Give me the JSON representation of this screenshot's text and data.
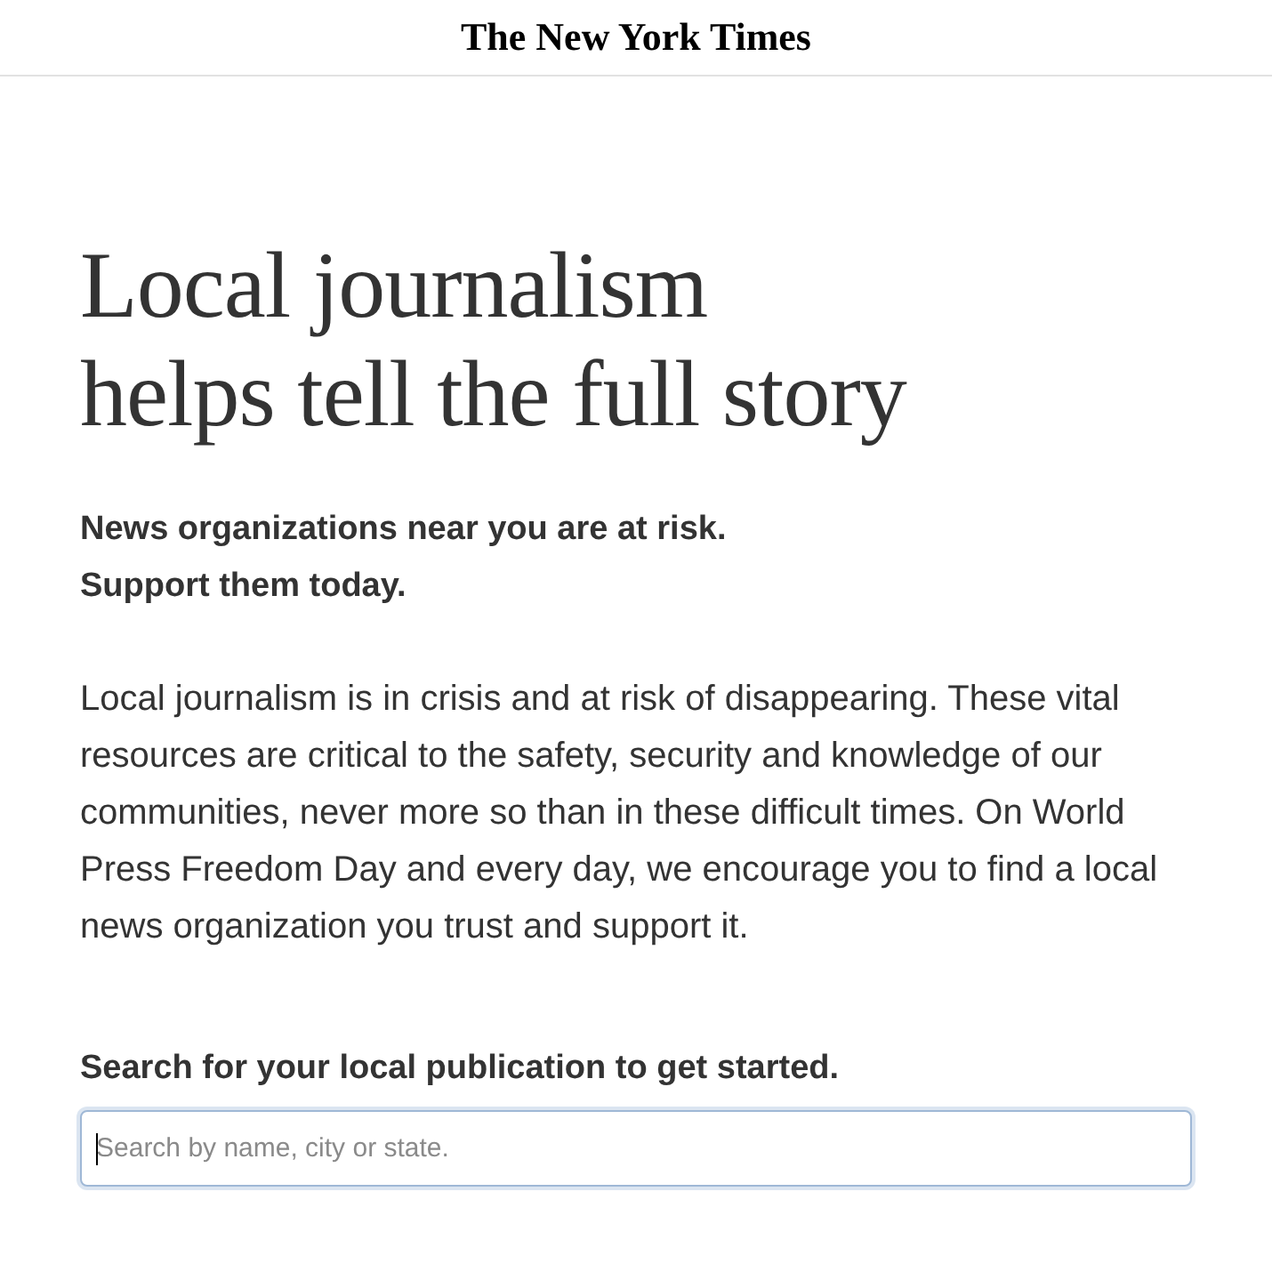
{
  "masthead": {
    "logo": "The New York Times"
  },
  "headline_lines": [
    "Local journalism",
    "helps tell the full story"
  ],
  "subheading_lines": [
    "News organizations near you are at risk.",
    "Support them today."
  ],
  "body": "Local journalism is in crisis and at risk of disappearing. These vital resources are critical to the safety, security and knowledge of our communities, never more so than in these difficult times. On World Press Freedom Day and every day, we encourage you to find a local news organization you trust and support it.",
  "search": {
    "label": "Search for your local publication to get started.",
    "placeholder": "Search by name, city or state.",
    "focused": true
  }
}
